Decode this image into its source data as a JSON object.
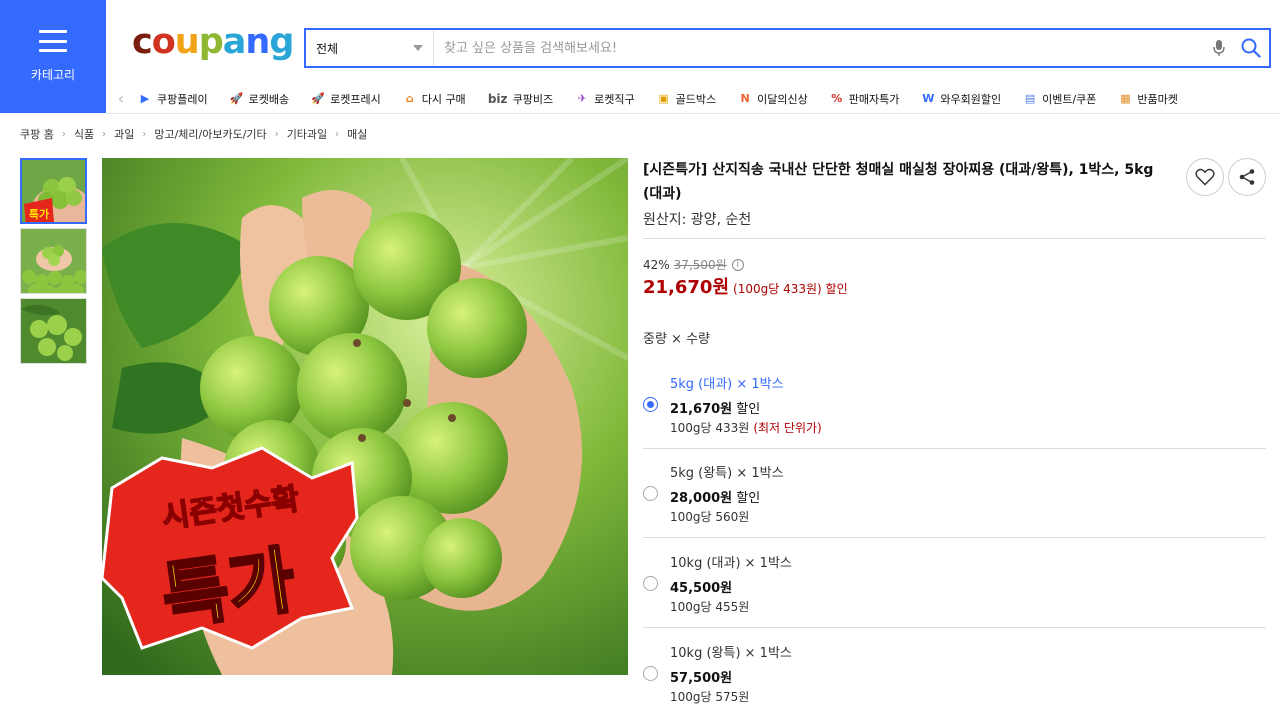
{
  "header": {
    "category_label": "카테고리",
    "logo_letters": [
      {
        "ch": "c",
        "color": "#7a1f0f"
      },
      {
        "ch": "o",
        "color": "#d0331f"
      },
      {
        "ch": "u",
        "color": "#f2a318"
      },
      {
        "ch": "p",
        "color": "#8fb832"
      },
      {
        "ch": "a",
        "color": "#2aa5d8"
      },
      {
        "ch": "n",
        "color": "#346aff"
      },
      {
        "ch": "g",
        "color": "#2aa5d8"
      }
    ],
    "search": {
      "scope": "전체",
      "placeholder": "찾고 싶은 상품을 검색해보세요!"
    }
  },
  "quicknav": [
    {
      "label": "쿠팡플레이",
      "icon": "play-icon",
      "color": "#346aff"
    },
    {
      "label": "로켓배송",
      "icon": "rocket-icon",
      "color": "#346aff"
    },
    {
      "label": "로켓프레시",
      "icon": "fresh-rocket-icon",
      "color": "#3aa13a"
    },
    {
      "label": "다시 구매",
      "icon": "home-icon",
      "color": "#f08020"
    },
    {
      "label": "쿠팡비즈",
      "icon": "biz-icon",
      "color": "#555555"
    },
    {
      "label": "로켓직구",
      "icon": "global-rocket-icon",
      "color": "#a040d0"
    },
    {
      "label": "골드박스",
      "icon": "goldbox-icon",
      "color": "#e0a000"
    },
    {
      "label": "이달의신상",
      "icon": "new-icon",
      "color": "#f06030"
    },
    {
      "label": "판매자특가",
      "icon": "percent-icon",
      "color": "#d03020"
    },
    {
      "label": "와우회원할인",
      "icon": "wow-icon",
      "color": "#346aff"
    },
    {
      "label": "이벤트/쿠폰",
      "icon": "coupon-icon",
      "color": "#4a7ae0"
    },
    {
      "label": "반품마켓",
      "icon": "return-market-icon",
      "color": "#e08a20"
    }
  ],
  "breadcrumb": [
    "쿠팡 홈",
    "식품",
    "과일",
    "망고/체리/아보카도/기타",
    "기타과일",
    "매실"
  ],
  "product": {
    "title": "[시즌특가] 산지직송 국내산 단단한 청매실 매실청 장아찌용 (대과/왕특), 1박스, 5kg (대과)",
    "origin": "원산지: 광양, 순천",
    "discount_rate": "42%",
    "original_price": "37,500원",
    "sale_price": "21,670원",
    "unit_note": "(100g당 433원) 할인",
    "badge_line1": "시즌첫수확",
    "badge_line2": "특가",
    "thumb_badge": "특가"
  },
  "options": {
    "header": "중량 × 수량",
    "items": [
      {
        "name": "5kg (대과) × 1박스",
        "price": "21,670원",
        "price_suffix": " 할인",
        "unit": "100g당 433원",
        "lowest": "(최저 단위가)",
        "selected": true
      },
      {
        "name": "5kg (왕특) × 1박스",
        "price": "28,000원",
        "price_suffix": " 할인",
        "unit": "100g당 560원",
        "lowest": "",
        "selected": false
      },
      {
        "name": "10kg (대과) × 1박스",
        "price": "45,500원",
        "price_suffix": "",
        "unit": "100g당 455원",
        "lowest": "",
        "selected": false
      },
      {
        "name": "10kg (왕특) × 1박스",
        "price": "57,500원",
        "price_suffix": "",
        "unit": "100g당 575원",
        "lowest": "",
        "selected": false
      }
    ]
  },
  "colors": {
    "brand_blue": "#346aff",
    "price_red": "#ae0000"
  }
}
